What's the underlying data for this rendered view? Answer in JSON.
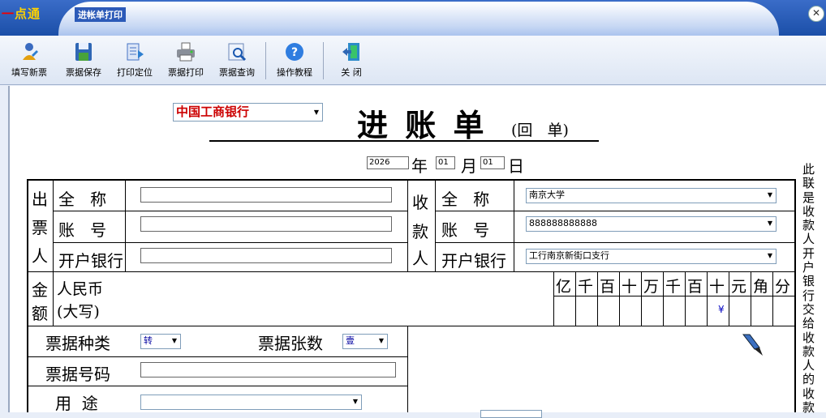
{
  "window": {
    "logo_mark": "一",
    "logo_text": "点通",
    "title": "进帐单打印",
    "close_symbol": "✕"
  },
  "toolbar": [
    {
      "label": "填写新票",
      "icon": "new-ticket-icon"
    },
    {
      "label": "票据保存",
      "icon": "save-icon"
    },
    {
      "label": "打印定位",
      "icon": "print-position-icon"
    },
    {
      "label": "票据打印",
      "icon": "printer-icon"
    },
    {
      "label": "票据查询",
      "icon": "search-icon"
    },
    {
      "label": "操作教程",
      "icon": "help-icon"
    },
    {
      "label": "关 闭",
      "icon": "exit-icon"
    }
  ],
  "form": {
    "bank_select": "中国工商银行",
    "title": "进 账 单",
    "subtitle": "(回   单)",
    "year": "2026",
    "year_label": "年",
    "month": "01",
    "month_label": "月",
    "day": "01",
    "day_label": "日",
    "payer": {
      "section": [
        "出",
        "票",
        "人"
      ],
      "name_label": "全   称",
      "account_label": "账   号",
      "bank_label": "开户银行",
      "name": "",
      "account": "",
      "bank": ""
    },
    "payee": {
      "section": [
        "收",
        "款",
        "人"
      ],
      "name_label": "全   称",
      "account_label": "账   号",
      "bank_label": "开户银行",
      "name": "南京大学",
      "account": "888888888888",
      "bank": "工行南京新街口支行"
    },
    "amount": {
      "section": [
        "金",
        "额"
      ],
      "label1": "人民币",
      "label2": "(大写)",
      "units": [
        "亿",
        "千",
        "百",
        "十",
        "万",
        "千",
        "百",
        "十",
        "元",
        "角",
        "分"
      ],
      "yen": "¥"
    },
    "ticket_type_label": "票据种类",
    "ticket_type": "转",
    "ticket_count_label": "票据张数",
    "ticket_count": "壹",
    "ticket_no_label": "票据号码",
    "ticket_no": "",
    "purpose_label": "用  途",
    "purpose": "",
    "side_note": "此联是收款人开户银行交给收款人的收款"
  }
}
